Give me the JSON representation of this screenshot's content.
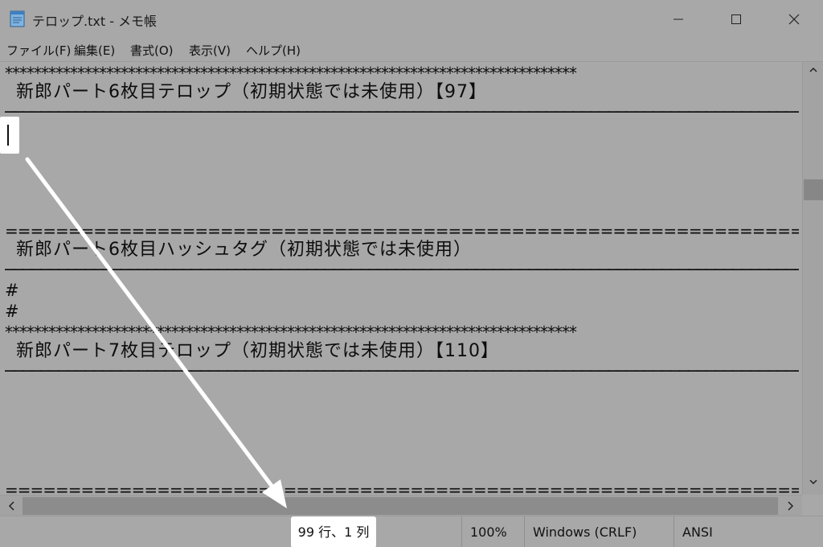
{
  "window": {
    "title": "テロップ.txt - メモ帳",
    "icon": "notepad-icon"
  },
  "menu": {
    "items": [
      "ファイル(F)",
      "編集(E)",
      "書式(O)",
      "表示(V)",
      "ヘルプ(H)"
    ]
  },
  "editor": {
    "lines": [
      "*******************************************************************************",
      "新郎パート6枚目テロップ（初期状態では未使用）【97】",
      "──────────────────────────────────────────────────────────────────────────────────────────",
      "",
      "",
      "",
      "",
      "================================================================================",
      "新郎パート6枚目ハッシュタグ（初期状態では未使用）",
      "──────────────────────────────────────────────────────────────────────────────────────────",
      "#",
      "#",
      "*******************************************************************************",
      "新郎パート7枚目テロップ（初期状態では未使用）【110】",
      "──────────────────────────────────────────────────────────────────────────────────────────",
      "",
      "",
      "",
      "",
      "================================================================================"
    ]
  },
  "status": {
    "position": "99 行、1 列",
    "zoom": "100%",
    "line_ending": "Windows (CRLF)",
    "encoding": "ANSI"
  },
  "colors": {
    "background": "#a8a8a8",
    "highlight": "#ffffff",
    "arrow": "#ffffff"
  }
}
